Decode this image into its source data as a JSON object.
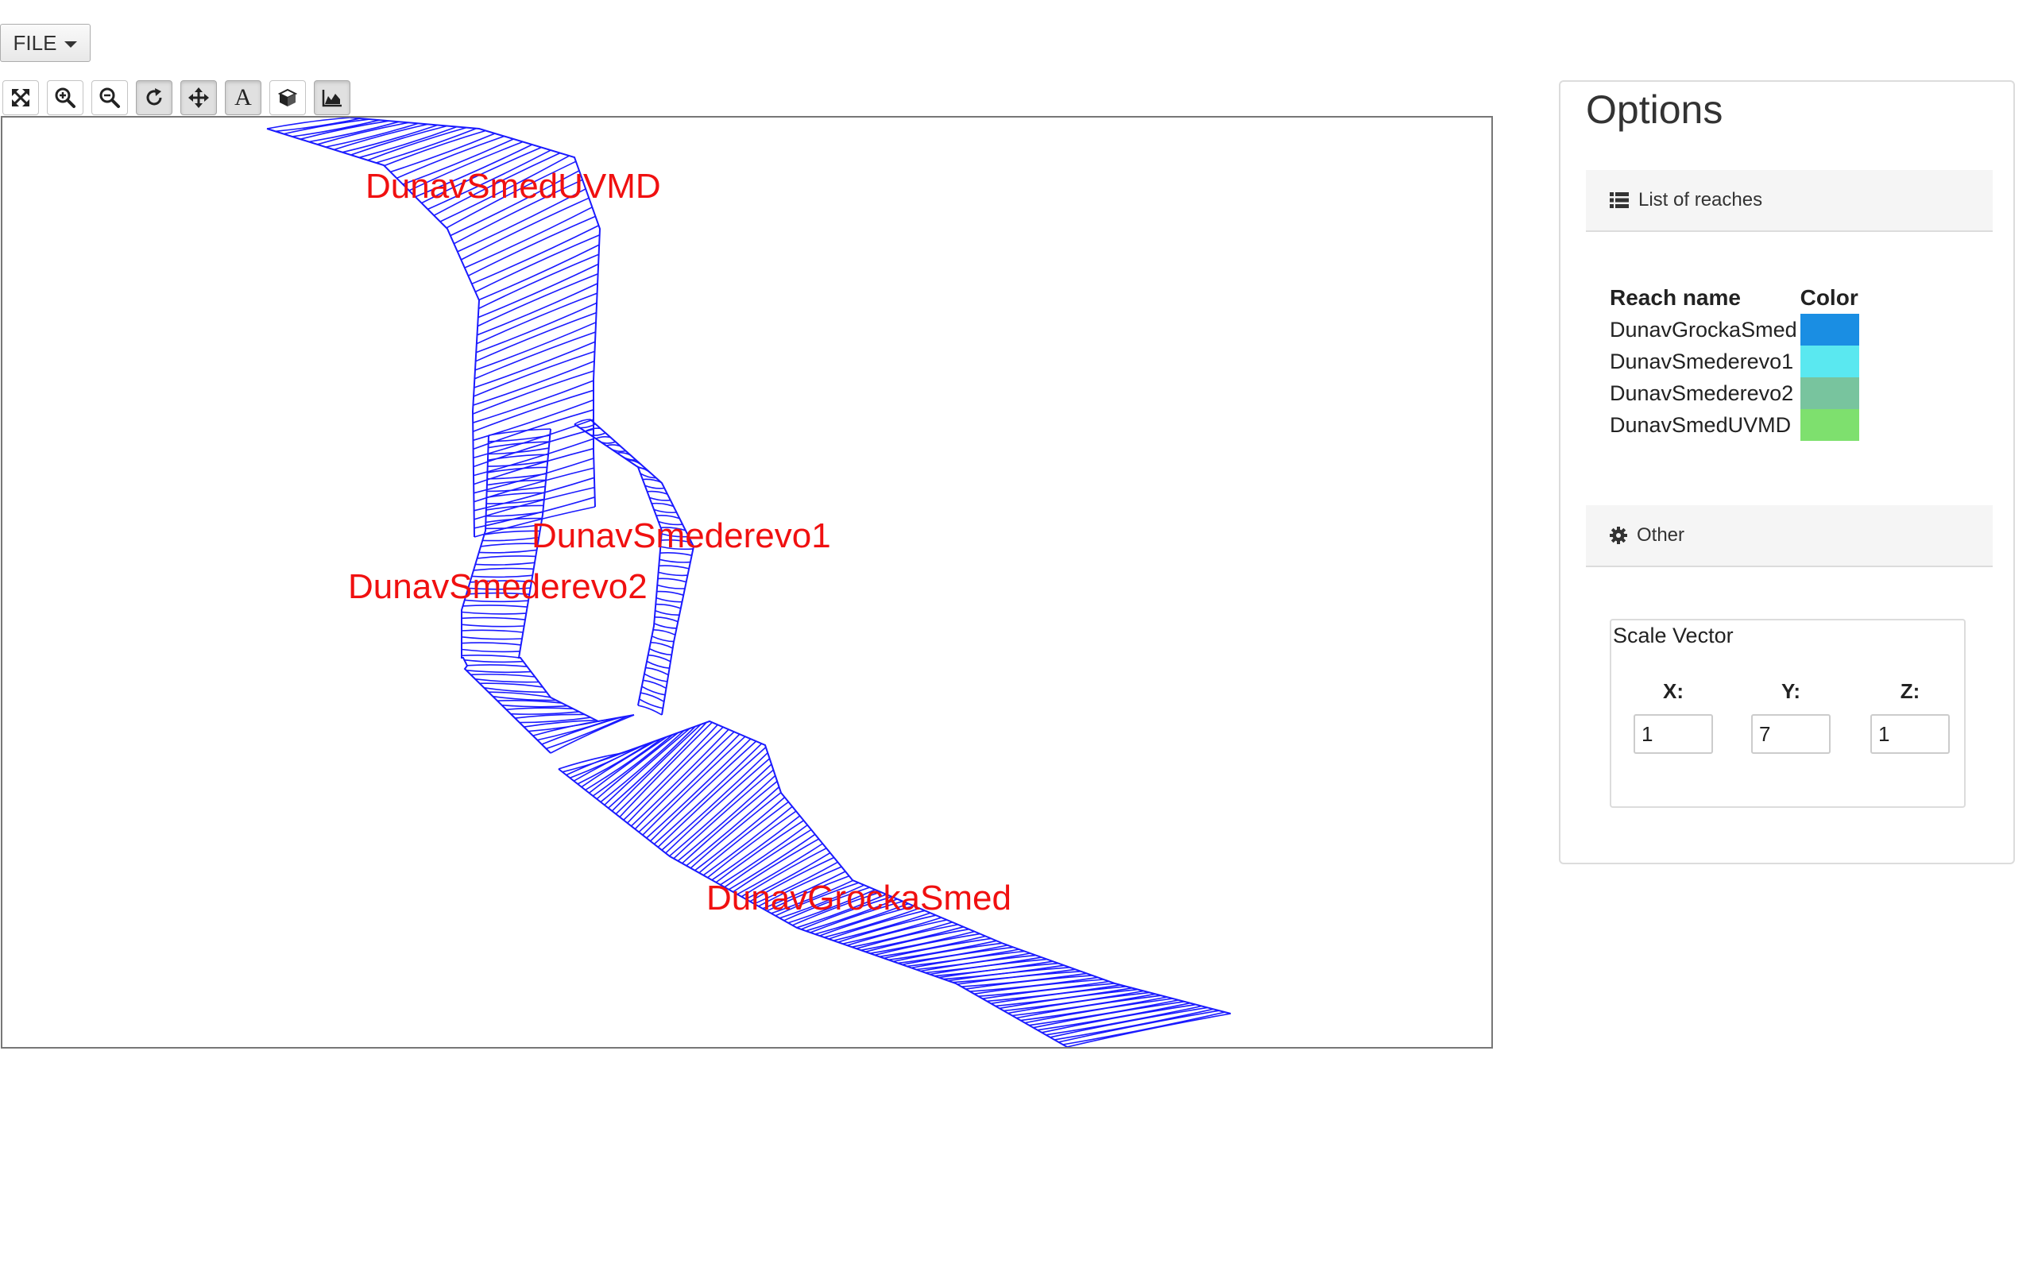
{
  "menu": {
    "file_label": "FILE"
  },
  "toolbar": {
    "tools": [
      {
        "name": "fit-screen",
        "active": false
      },
      {
        "name": "zoom-in",
        "active": false
      },
      {
        "name": "zoom-out",
        "active": false
      },
      {
        "name": "rotate",
        "active": true
      },
      {
        "name": "pan",
        "active": true
      },
      {
        "name": "text-labels",
        "label": "A",
        "active": true
      },
      {
        "name": "3d-view",
        "active": false
      },
      {
        "name": "terrain-view",
        "active": true
      }
    ]
  },
  "viewer": {
    "mesh_color": "#1a1aff",
    "label_color": "#f01010",
    "labels": {
      "uvmd": "DunavSmedUVMD",
      "smed1": "DunavSmederevo1",
      "smed2": "DunavSmederevo2",
      "grocka": "DunavGrockaSmed"
    }
  },
  "options": {
    "title": "Options",
    "reaches_section": {
      "title": "List of reaches",
      "col_name": "Reach name",
      "col_color": "Color",
      "rows": [
        {
          "name": "DunavGrockaSmed",
          "color": "#1a8ee3"
        },
        {
          "name": "DunavSmederevo1",
          "color": "#5ae8f0"
        },
        {
          "name": "DunavSmederevo2",
          "color": "#78c49e"
        },
        {
          "name": "DunavSmedUVMD",
          "color": "#7ee06e"
        }
      ]
    },
    "other_section": {
      "title": "Other",
      "scale_vector": {
        "legend": "Scale Vector",
        "x_label": "X:",
        "y_label": "Y:",
        "z_label": "Z:",
        "x": "1",
        "y": "7",
        "z": "1"
      }
    }
  }
}
